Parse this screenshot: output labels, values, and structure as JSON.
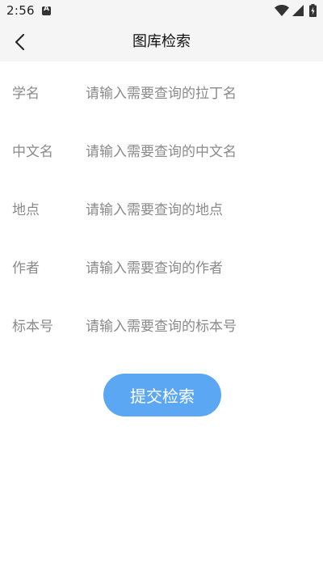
{
  "status_bar": {
    "time": "2:56",
    "notification_icon": "a-square-icon",
    "wifi_icon": "wifi-icon",
    "signal_icon": "signal-icon",
    "battery_icon": "battery-charging-icon"
  },
  "nav": {
    "back_icon": "chevron-left-icon",
    "title": "图库检索"
  },
  "form": {
    "fields": [
      {
        "label": "学名",
        "placeholder": "请输入需要查询的拉丁名",
        "value": ""
      },
      {
        "label": "中文名",
        "placeholder": "请输入需要查询的中文名",
        "value": ""
      },
      {
        "label": "地点",
        "placeholder": "请输入需要查询的地点",
        "value": ""
      },
      {
        "label": "作者",
        "placeholder": "请输入需要查询的作者",
        "value": ""
      },
      {
        "label": "标本号",
        "placeholder": "请输入需要查询的标本号",
        "value": ""
      }
    ],
    "submit_label": "提交检索"
  },
  "colors": {
    "accent": "#5ba7f3",
    "label_gray": "#8a8a8a",
    "header_bg": "#f5f5f5"
  }
}
